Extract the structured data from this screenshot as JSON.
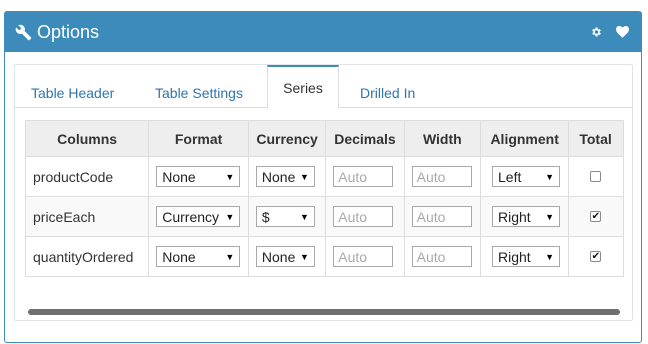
{
  "panel": {
    "title": "Options",
    "header_icon": "wrench-icon",
    "actions": [
      "gear-icon",
      "heart-icon"
    ]
  },
  "tabs": [
    {
      "label": "Table Header",
      "active": false
    },
    {
      "label": "Table Settings",
      "active": false
    },
    {
      "label": "Series",
      "active": true
    },
    {
      "label": "Drilled In",
      "active": false
    }
  ],
  "table": {
    "headers": [
      "Columns",
      "Format",
      "Currency",
      "Decimals",
      "Width",
      "Alignment",
      "Total"
    ],
    "rows": [
      {
        "column": "productCode",
        "format": "None",
        "currency": "None",
        "decimals_placeholder": "Auto",
        "width_placeholder": "Auto",
        "alignment": "Left",
        "total": false
      },
      {
        "column": "priceEach",
        "format": "Currency",
        "currency": "$",
        "decimals_placeholder": "Auto",
        "width_placeholder": "Auto",
        "alignment": "Right",
        "total": true
      },
      {
        "column": "quantityOrdered",
        "format": "None",
        "currency": "None",
        "decimals_placeholder": "Auto",
        "width_placeholder": "Auto",
        "alignment": "Right",
        "total": true
      }
    ]
  },
  "colors": {
    "header_bg": "#3d8bbb",
    "tab_link": "#2f75b0",
    "table_header_bg": "#eeeeee"
  }
}
